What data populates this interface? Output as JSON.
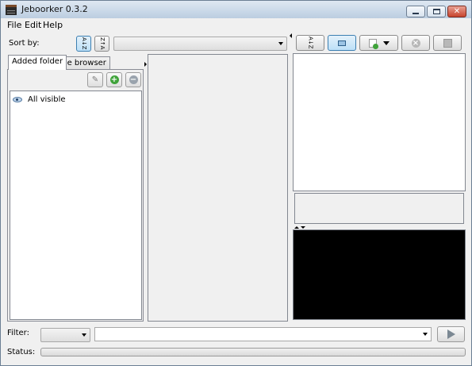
{
  "window": {
    "title": "Jeboorker 0.3.2"
  },
  "menu": {
    "file": "File",
    "edit": "Edit",
    "help": "Help"
  },
  "toolbar": {
    "sort_label": "Sort by:",
    "sort_desc_glyph": "A↓Z",
    "sort_asc_glyph": "Z↑A",
    "sort_field_value": ""
  },
  "left_panel": {
    "tabs": [
      "Added folder",
      "File browser"
    ],
    "selected_tab": "Added folder",
    "items": [
      {
        "label": "All visible",
        "icon": "eye-icon"
      }
    ]
  },
  "right_toolbar": {
    "sort_glyph": "A↓Z",
    "icons": [
      "sort-icon",
      "view-mode-icon",
      "add-metadata-icon",
      "delete-icon",
      "save-icon"
    ]
  },
  "filter": {
    "label": "Filter:",
    "field_value": "",
    "text": ""
  },
  "status": {
    "label": "Status:",
    "progress": 0
  },
  "colors": {
    "accent": "#3c7fb1",
    "preview_bg": "#000000",
    "add_green": "#3fa33a"
  }
}
